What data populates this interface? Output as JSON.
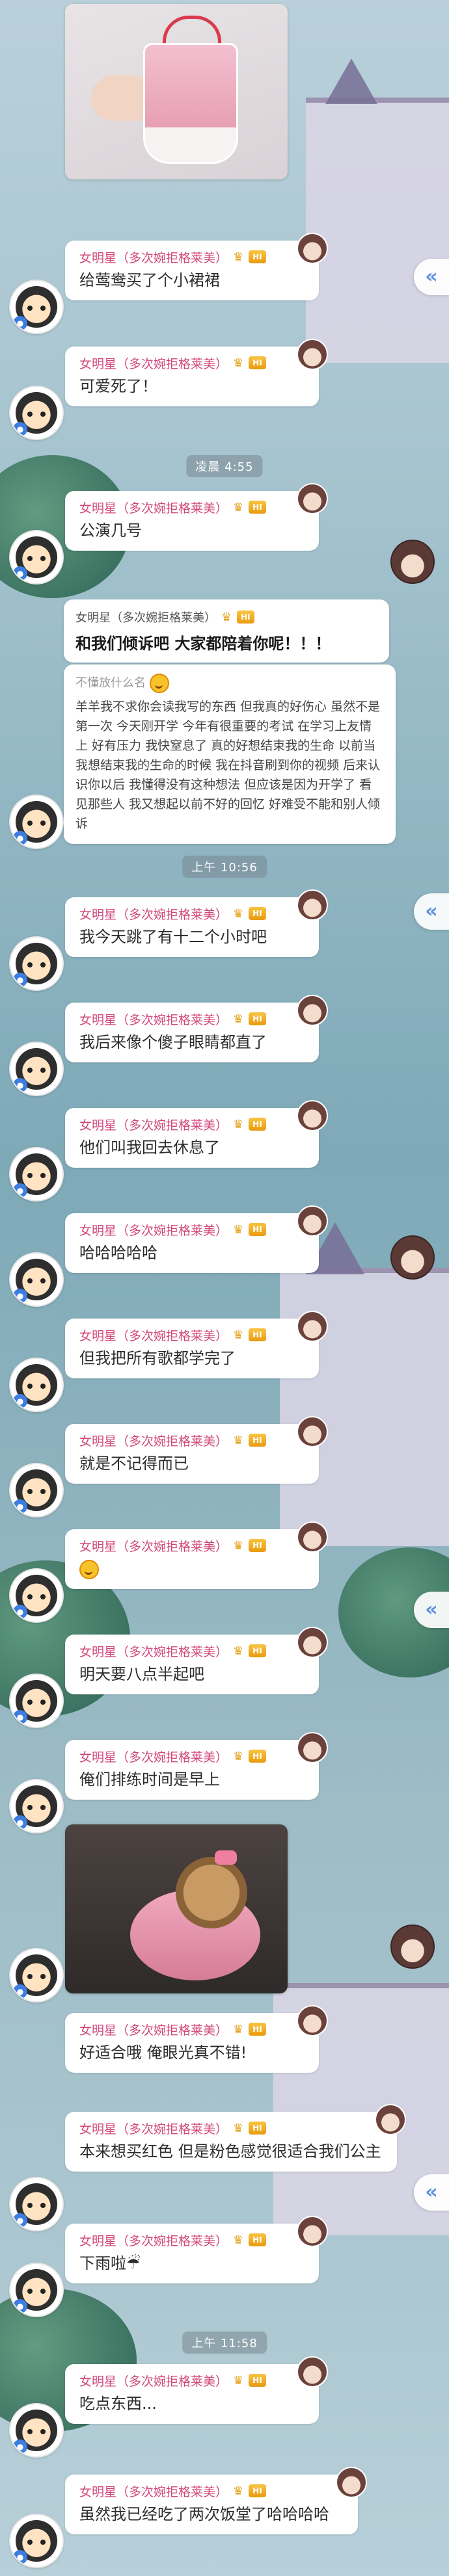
{
  "sender": {
    "nickname": "女明星（多次婉拒格莱美）",
    "level_tag": "HI"
  },
  "photo_1": {
    "description_icon": "pink-dress-photo"
  },
  "photo_2": {
    "description_icon": "dog-in-pink-dress-photo"
  },
  "messages": [
    {
      "text": "给莺鸯买了个小裙裙"
    },
    {
      "text": "可爱死了！"
    },
    {
      "text": "公演几号"
    },
    {
      "text": "我今天跳了有十二个小时吧"
    },
    {
      "text": "我后来像个傻子眼睛都直了"
    },
    {
      "text": "他们叫我回去休息了"
    },
    {
      "text": "哈哈哈哈哈"
    },
    {
      "text": "但我把所有歌都学完了"
    },
    {
      "text": "就是不记得而已"
    },
    {
      "text": ""
    },
    {
      "text": "明天要八点半起吧"
    },
    {
      "text": "俺们排练时间是早上"
    },
    {
      "text": "好适合哦 俺眼光真不错!"
    },
    {
      "text": "本来想买红色 但是粉色感觉很适合我们公主"
    },
    {
      "text": "下雨啦☔"
    },
    {
      "text": "吃点东西..."
    },
    {
      "text": "虽然我已经吃了两次饭堂了哈哈哈哈"
    }
  ],
  "times": {
    "t1": "凌晨 4:55",
    "t2": "上午 10:56",
    "t3": "上午 11:58"
  },
  "system": {
    "title": "和我们倾诉吧 大家都陪着你呢！！！",
    "sub_name": "不懂放什么名",
    "body": "羊羊我不求你会读我写的东西 但我真的好伤心 虽然不是第一次 今天刚开学 今年有很重要的考试 在学习上友情上 好有压力 我快窒息了 真的好想结束我的生命 以前当我想结束我的生命的时候 我在抖音刷到你的视频 后来认识你以后 我懂得没有这种想法 但应该是因为开学了 看见那些人 我又想起以前不好的回忆 好难受不能和别人倾诉"
  },
  "ui": {
    "scroll_tab_glyph": "«",
    "crown_glyph": "♛",
    "avatar_badge": "●"
  },
  "colors": {
    "nickname": "#d2477a",
    "level_tag": "#e89b10",
    "scroll_tab": "#5d8fe0"
  }
}
